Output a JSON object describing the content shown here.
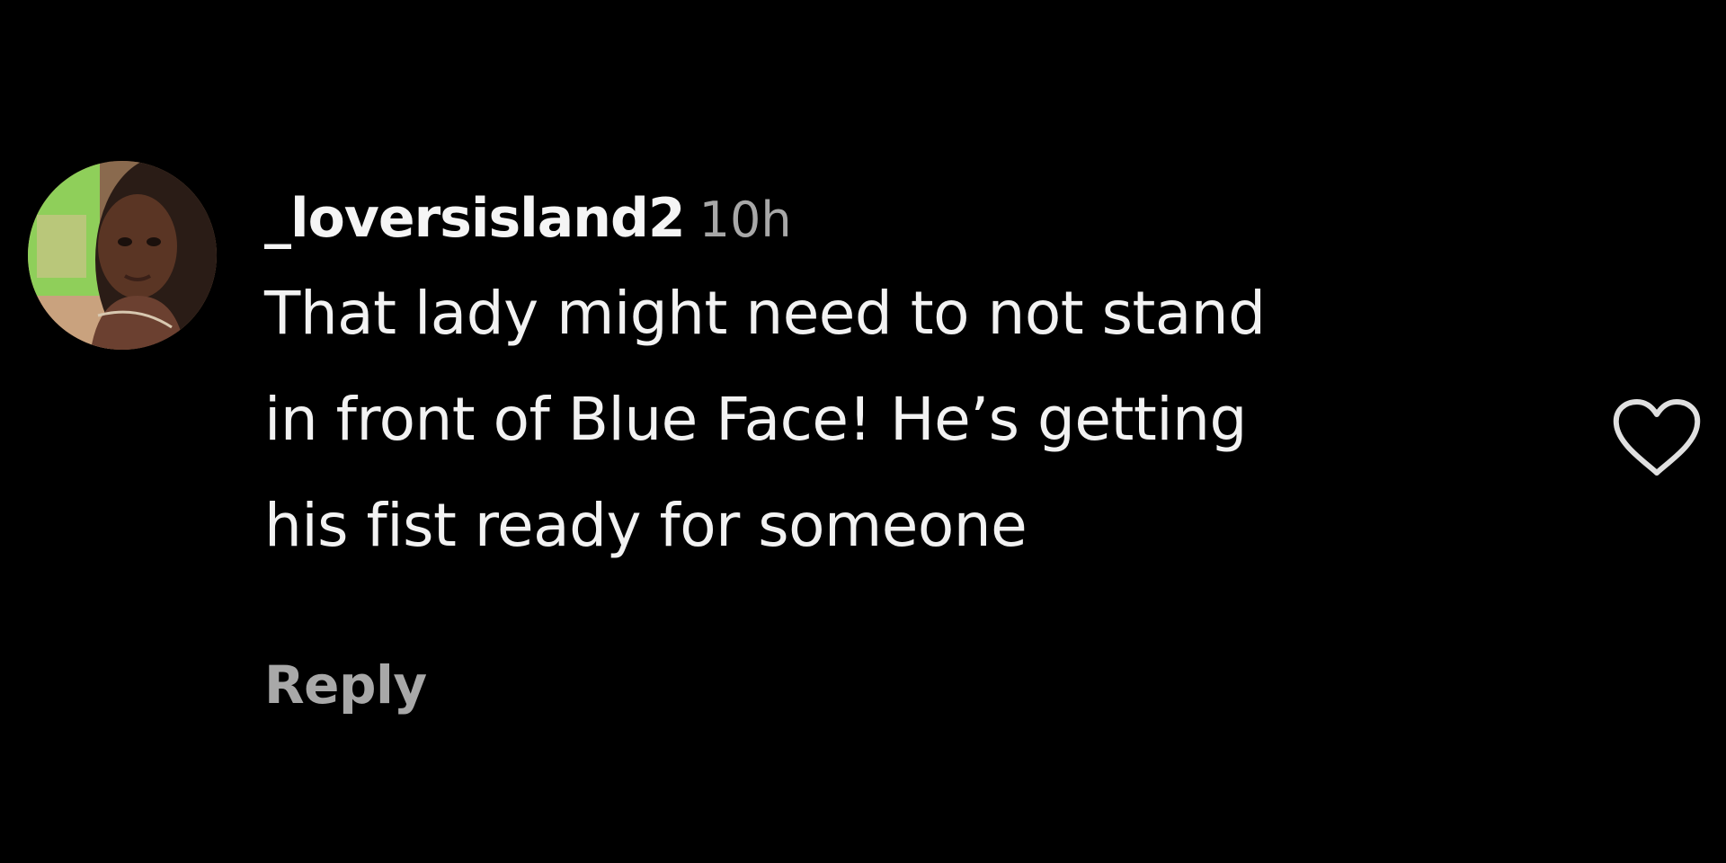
{
  "comment": {
    "avatar_icon": "user-avatar-photo",
    "username": "_loversisland2",
    "timestamp": "10h",
    "text_lines": [
      "That lady might need to not stand",
      "in front of Blue Face! He’s getting",
      "his fist ready for someone"
    ],
    "reply_label": "Reply",
    "like_icon": "heart-outline-icon",
    "liked": false
  },
  "colors": {
    "background": "#000000",
    "primary_text": "#f2f2f2",
    "secondary_text": "#a8a8a8",
    "icon_stroke": "#e0e0e0"
  }
}
